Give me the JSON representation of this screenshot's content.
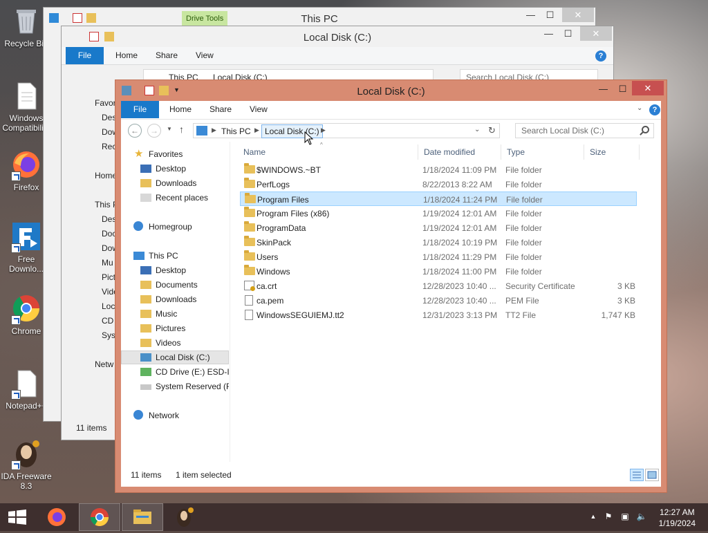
{
  "desktop": {
    "icons": [
      {
        "label": "Recycle Bin",
        "icon": "recycle-bin-icon"
      },
      {
        "label": "Windows Compatibili...",
        "icon": "document-icon"
      },
      {
        "label": "Firefox",
        "icon": "firefox-icon"
      },
      {
        "label": "Free Downlo...",
        "icon": "free-download-manager-icon"
      },
      {
        "label": "Chrome",
        "icon": "chrome-icon"
      },
      {
        "label": "Notepad++",
        "icon": "notepad-plus-plus-icon"
      },
      {
        "label": "IDA Freeware 8.3",
        "icon": "ida-freeware-icon"
      }
    ]
  },
  "back_window_1": {
    "title": "This PC",
    "contextual_tab": "Drive Tools"
  },
  "back_window_2": {
    "title": "Local Disk (C:)",
    "tabs": [
      "File",
      "Home",
      "Share",
      "View"
    ],
    "breadcrumb": [
      "This PC",
      "Local Disk (C:)"
    ],
    "search_placeholder": "Search Local Disk (C:)",
    "nav_partial": [
      "Favor",
      "Des",
      "Dow",
      "Rec",
      "Home",
      "This P",
      "Des",
      "Doc",
      "Dow",
      "Mu",
      "Pict",
      "Vide",
      "Loc",
      "CD",
      "Syst",
      "Netw"
    ],
    "status": "11 items"
  },
  "window": {
    "title": "Local Disk (C:)",
    "controls": {
      "minimize": "—",
      "maximize": "☐",
      "close": "✕"
    },
    "ribbon_tabs": {
      "file": "File",
      "home": "Home",
      "share": "Share",
      "view": "View"
    },
    "address": {
      "root": "This PC",
      "current": "Local Disk (C:)"
    },
    "search_placeholder": "Search Local Disk (C:)",
    "nav": {
      "favorites": "Favorites",
      "desktop": "Desktop",
      "downloads": "Downloads",
      "recent": "Recent places",
      "homegroup": "Homegroup",
      "this_pc": "This PC",
      "pc_desktop": "Desktop",
      "documents": "Documents",
      "pc_downloads": "Downloads",
      "music": "Music",
      "pictures": "Pictures",
      "videos": "Videos",
      "local_disk": "Local Disk (C:)",
      "cd_drive": "CD Drive (E:) ESD-ISO",
      "system_reserved": "System Reserved (F:)",
      "network": "Network"
    },
    "columns": {
      "name": "Name",
      "date": "Date modified",
      "type": "Type",
      "size": "Size"
    },
    "files": [
      {
        "name": "$WINDOWS.~BT",
        "date": "1/18/2024 11:09 PM",
        "type": "File folder",
        "size": "",
        "icon": "folder-icon",
        "selected": false
      },
      {
        "name": "PerfLogs",
        "date": "8/22/2013 8:22 AM",
        "type": "File folder",
        "size": "",
        "icon": "folder-icon",
        "selected": false
      },
      {
        "name": "Program Files",
        "date": "1/18/2024 11:24 PM",
        "type": "File folder",
        "size": "",
        "icon": "folder-icon",
        "selected": true
      },
      {
        "name": "Program Files (x86)",
        "date": "1/19/2024 12:01 AM",
        "type": "File folder",
        "size": "",
        "icon": "folder-icon",
        "selected": false
      },
      {
        "name": "ProgramData",
        "date": "1/19/2024 12:01 AM",
        "type": "File folder",
        "size": "",
        "icon": "folder-icon",
        "selected": false
      },
      {
        "name": "SkinPack",
        "date": "1/18/2024 10:19 PM",
        "type": "File folder",
        "size": "",
        "icon": "folder-icon",
        "selected": false
      },
      {
        "name": "Users",
        "date": "1/18/2024 11:29 PM",
        "type": "File folder",
        "size": "",
        "icon": "folder-icon",
        "selected": false
      },
      {
        "name": "Windows",
        "date": "1/18/2024 11:00 PM",
        "type": "File folder",
        "size": "",
        "icon": "folder-icon",
        "selected": false
      },
      {
        "name": "ca.crt",
        "date": "12/28/2023 10:40 ...",
        "type": "Security Certificate",
        "size": "3 KB",
        "icon": "certificate-icon",
        "selected": false
      },
      {
        "name": "ca.pem",
        "date": "12/28/2023 10:40 ...",
        "type": "PEM File",
        "size": "3 KB",
        "icon": "file-icon",
        "selected": false
      },
      {
        "name": "WindowsSEGUIEMJ.tt2",
        "date": "12/31/2023 3:13 PM",
        "type": "TT2 File",
        "size": "1,747 KB",
        "icon": "file-icon",
        "selected": false
      }
    ],
    "status": {
      "count": "11 items",
      "selection": "1 item selected"
    }
  },
  "taskbar": {
    "time": "12:27 AM",
    "date": "1/19/2024"
  },
  "colors": {
    "accent": "#1979ca",
    "window_frame": "#d88b72",
    "selection": "#cce8ff",
    "close_button": "#c75050"
  }
}
